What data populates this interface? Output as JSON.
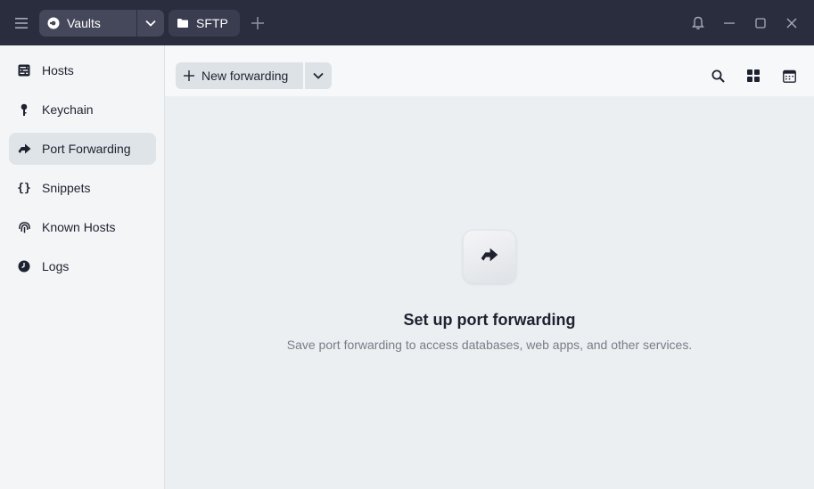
{
  "titlebar": {
    "vaults_label": "Vaults",
    "sftp_label": "SFTP"
  },
  "sidebar": {
    "items": [
      {
        "label": "Hosts",
        "icon": "hosts-icon"
      },
      {
        "label": "Keychain",
        "icon": "key-icon"
      },
      {
        "label": "Port Forwarding",
        "icon": "port-forwarding-icon",
        "active": true
      },
      {
        "label": "Snippets",
        "icon": "braces-icon"
      },
      {
        "label": "Known Hosts",
        "icon": "fingerprint-icon"
      },
      {
        "label": "Logs",
        "icon": "clock-icon"
      }
    ]
  },
  "toolbar": {
    "new_label": "New forwarding"
  },
  "empty_state": {
    "title": "Set up port forwarding",
    "subtitle": "Save port forwarding to access databases, web apps, and other services."
  },
  "colors": {
    "titlebar_bg": "#2a2d3e",
    "sidebar_bg": "#f4f5f7",
    "active_item_bg": "#dfe4e8",
    "content_bg": "#eceff1"
  }
}
